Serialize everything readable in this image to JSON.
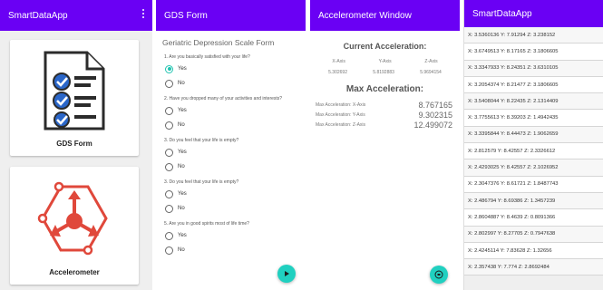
{
  "colors": {
    "appbar": "#6a00f4",
    "accent": "#20d0c0",
    "icon_blue": "#2a66c9",
    "icon_red": "#e0483b"
  },
  "panel1": {
    "title": "SmartDataApp",
    "menu_icon": "overflow-menu-icon",
    "cards": [
      {
        "label": "GDS Form",
        "icon": "checklist-document-icon"
      },
      {
        "label": "Accelerometer",
        "icon": "accelerometer-axes-icon"
      }
    ]
  },
  "panel2": {
    "title": "GDS Form",
    "form_title": "Geriatric Depression Scale Form",
    "questions": [
      {
        "text": "1. Are you basically satisfied with your life?",
        "yes": "Yes",
        "no": "No",
        "selected": "Yes"
      },
      {
        "text": "2. Have you dropped many of your activities and interests?",
        "yes": "Yes",
        "no": "No",
        "selected": ""
      },
      {
        "text": "3. Do you feel that your life is empty?",
        "yes": "Yes",
        "no": "No",
        "selected": ""
      },
      {
        "text": "3. Do you feel that your life is empty?",
        "yes": "Yes",
        "no": "No",
        "selected": ""
      },
      {
        "text": "5. Are you in good spirits most of life time?",
        "yes": "Yes",
        "no": "No",
        "selected": ""
      }
    ],
    "fab_icon": "play-arrow-icon"
  },
  "panel3": {
    "title": "Accelerometer Window",
    "current_heading": "Current Acceleration:",
    "axes": [
      "X-Axis",
      "Y-Axis",
      "Z-Axis"
    ],
    "current_values": [
      "5.302692",
      "5.8192883",
      "5.9694154"
    ],
    "max_heading": "Max Acceleration:",
    "max_rows": [
      {
        "label": "Max Acceleration: X-Axis",
        "value": "8.767165"
      },
      {
        "label": "Max Acceleration: Y-Axis",
        "value": "9.302315"
      },
      {
        "label": "Max Acceleration: Z-Axis",
        "value": "12.499072"
      }
    ],
    "fab_icon": "stop-circle-icon"
  },
  "panel4": {
    "title": "SmartDataApp",
    "readings": [
      "X: 3.5360136  Y: 7.91294  Z: 3.238152",
      "X: 3.6749513  Y: 8.17165  Z: 3.1806605",
      "X: 3.3347933  Y: 8.24351  Z: 3.6310105",
      "X: 3.2054374  Y: 8.21477  Z: 3.1806605",
      "X: 3.5408044  Y: 8.22435  Z: 2.1314409",
      "X: 3.7755613  Y: 8.39203  Z: 1.4942435",
      "X: 3.3395844  Y: 8.44473  Z: 1.9062659",
      "X: 2.812579  Y: 8.42557  Z: 2.3326612",
      "X: 2.4293025  Y: 8.42557  Z: 2.1026952",
      "X: 2.3047376  Y: 8.61721  Z: 1.8487743",
      "X: 2.486794  Y: 8.69386  Z: 1.3457239",
      "X: 2.8604887  Y: 8.4639  Z: 0.8091366",
      "X: 2.802997  Y: 8.27705  Z: 0.7947638",
      "X: 2.4245114  Y: 7.83628  Z: 1.32656",
      "X: 2.357438  Y: 7.774  Z: 2.8692484"
    ]
  }
}
